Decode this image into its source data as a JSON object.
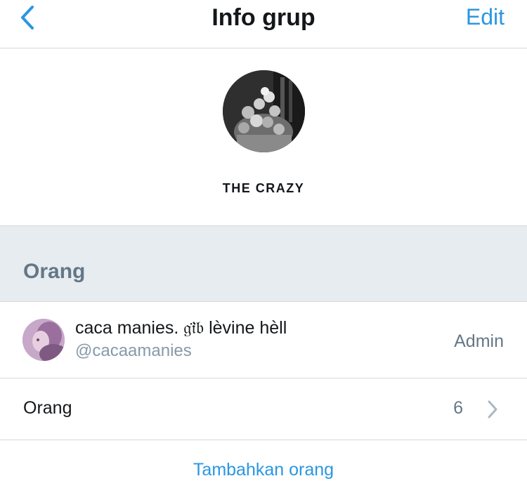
{
  "navbar": {
    "back_icon": "chevron-left-icon",
    "title": "Info grup",
    "edit_label": "Edit",
    "accent_color": "#2a97e0"
  },
  "group": {
    "avatar_icon": "group-photo",
    "name": "THE CRAZY"
  },
  "section": {
    "title": "Orang"
  },
  "members": [
    {
      "avatar_icon": "user-avatar",
      "name": "caca manies. 𝔤𝔦̈𝔟 lèvine hèll",
      "handle": "@cacaamanies",
      "role": "Admin"
    }
  ],
  "people_row": {
    "label": "Orang",
    "count": "6",
    "icon": "chevron-right-icon"
  },
  "add_people": {
    "label": "Tambahkan orang"
  }
}
